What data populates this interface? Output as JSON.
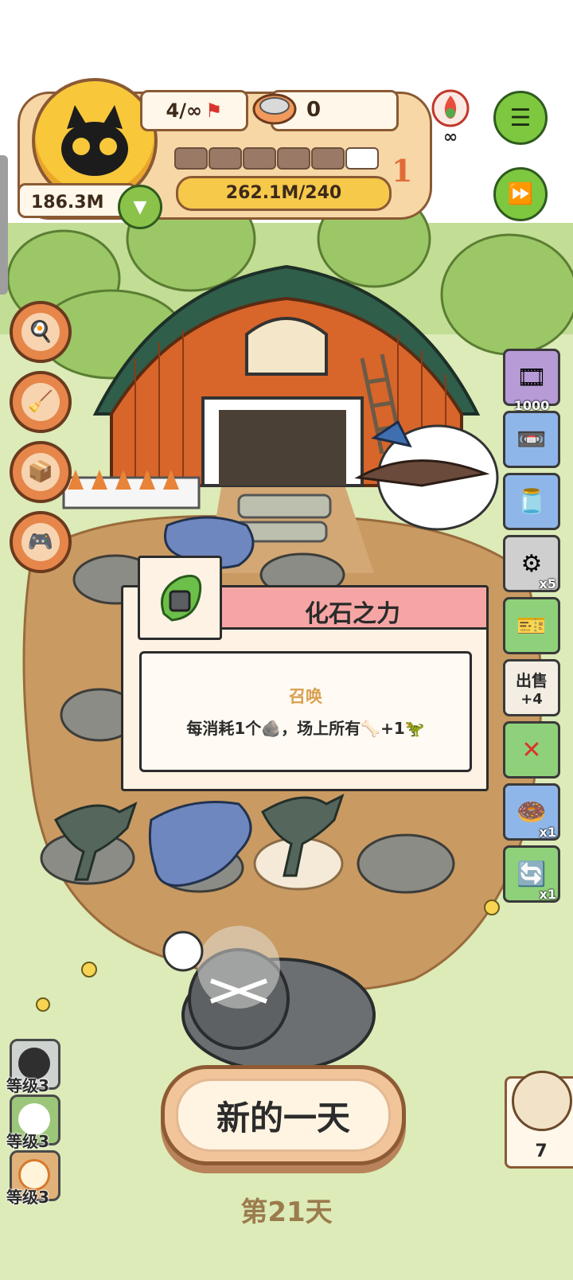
{
  "hud": {
    "capacity": "4/∞",
    "bowl_count": "0",
    "coins": "186.3M",
    "exp": "262.1M/240",
    "level": "1",
    "level_bar_segments_filled": 5,
    "level_bar_segments_total": 6,
    "fire_badge": "∞"
  },
  "left_skills": [
    {
      "icon": "pan-icon"
    },
    {
      "icon": "mop-icon"
    },
    {
      "icon": "box-icon"
    },
    {
      "icon": "handheld-console-icon"
    }
  ],
  "right_items": [
    {
      "icon": "film-reel-icon",
      "count": "1000"
    },
    {
      "icon": "tape-measure-icon",
      "count": ""
    },
    {
      "icon": "jar-icon",
      "count": ""
    },
    {
      "icon": "engine-icon",
      "count": "x5"
    },
    {
      "icon": "ticket-icon",
      "count": ""
    },
    {
      "icon": "sell-icon",
      "label": "出售",
      "count": "+4"
    },
    {
      "icon": "x1-ticket-icon",
      "count": ""
    },
    {
      "icon": "donut-icon",
      "count": "x1"
    },
    {
      "icon": "refresh-ticket-icon",
      "count": "x1"
    }
  ],
  "popup": {
    "title": "化石之力",
    "subtitle": "召唤",
    "description": "每消耗1个🪨，场上所有🦴+1🦖",
    "icon": "fossil-power-icon"
  },
  "badges": [
    {
      "icon": "creature-gray-icon",
      "label": "等级3"
    },
    {
      "icon": "creature-green-icon",
      "label": "等级3"
    },
    {
      "icon": "creature-orange-icon",
      "label": "等级3"
    }
  ],
  "new_day_button": "新的一天",
  "day_label": "第21天",
  "side_card_count": "7",
  "colors": {
    "hud_panel": "#f7d7a6",
    "popup_header": "#f5a6a4",
    "grass": "#cfe2a4",
    "dirt": "#c6925a"
  }
}
